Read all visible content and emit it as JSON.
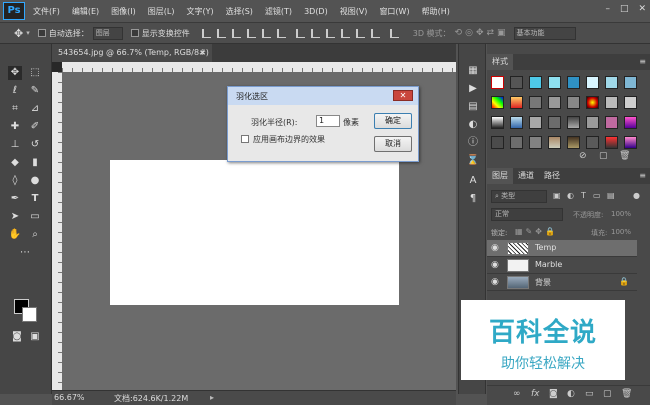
{
  "app": {
    "logo": "Ps"
  },
  "menu": [
    "文件(F)",
    "编辑(E)",
    "图像(I)",
    "图层(L)",
    "文字(Y)",
    "选择(S)",
    "滤镜(T)",
    "3D(D)",
    "视图(V)",
    "窗口(W)",
    "帮助(H)"
  ],
  "window_controls": {
    "minimize": "–",
    "restore": "□",
    "close": "✕"
  },
  "options": {
    "auto_select_label": "自动选择：",
    "auto_select_value": "图层",
    "show_transform_label": "显示变换控件",
    "mode_3d_label": "3D 模式：",
    "workspace": "基本功能"
  },
  "document": {
    "tab_title": "543654.jpg @ 66.7% (Temp, RGB/8#) *",
    "tab_close": "×",
    "zoom": "66.67%",
    "doc_size": "文档:624.6K/1.22M"
  },
  "dialog": {
    "title": "羽化选区",
    "close": "✕",
    "radius_label": "羽化半径(R):",
    "radius_value": "1",
    "unit": "像素",
    "apply_label": "应用画布边界的效果",
    "ok": "确定",
    "cancel": "取消"
  },
  "panels": {
    "styles_tab": "样式",
    "layers_tab": "图层",
    "channels_tab": "通道",
    "paths_tab": "路径",
    "kind_filter": "类型",
    "blend_mode": "正常",
    "opacity_label": "不透明度:",
    "opacity_value": "100%",
    "lock_label": "锁定:",
    "fill_label": "填充:",
    "fill_value": "100%",
    "layers": [
      {
        "name": "Temp",
        "thumb_color": "#dddddd"
      },
      {
        "name": "Marble",
        "thumb_color": "#f2f2f2"
      },
      {
        "name": "背景",
        "thumb_color": "#6f8fa0"
      }
    ]
  },
  "watermark": {
    "title": "百科全说",
    "subtitle": "助你轻松解决"
  },
  "colors": {
    "accent": "#31a8ff",
    "dialog_title_bg": "#c9daf2",
    "close_red": "#c9463d",
    "watermark": "#2fa9c6"
  }
}
